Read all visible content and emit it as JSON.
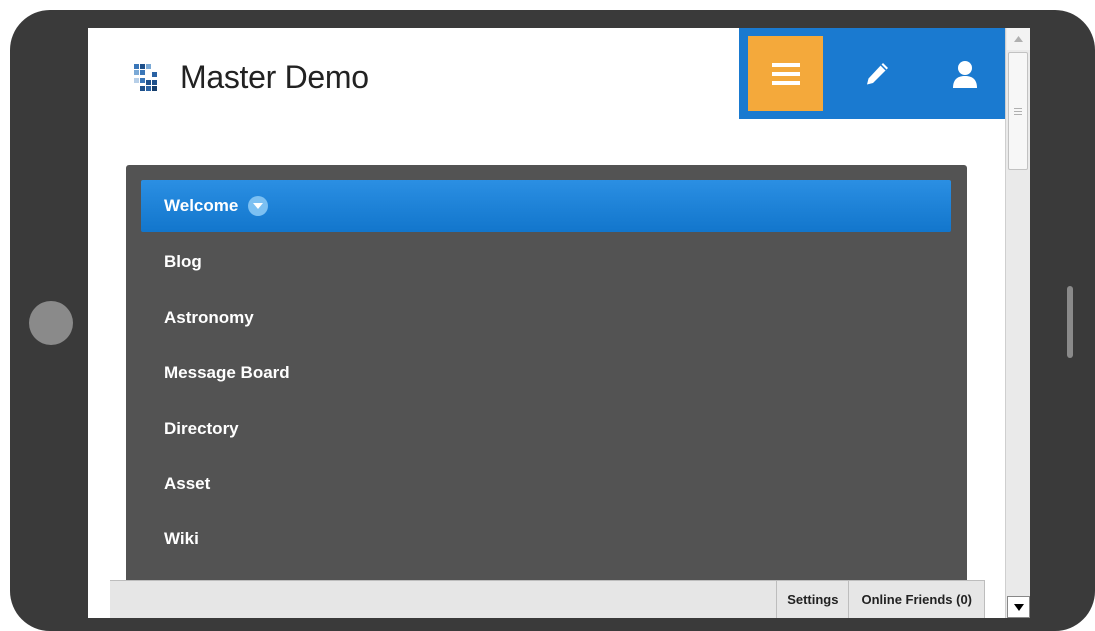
{
  "site": {
    "title": "Master Demo",
    "logo_icon": "grid-logo-icon"
  },
  "header_controls": {
    "menu_icon": "hamburger-icon",
    "edit_icon": "pencil-icon",
    "user_icon": "user-icon",
    "menu_color": "#f4a93b",
    "bar_color": "#1a7ad0"
  },
  "nav": {
    "items": [
      {
        "label": "Welcome",
        "active": true
      },
      {
        "label": "Blog"
      },
      {
        "label": "Astronomy"
      },
      {
        "label": "Message Board"
      },
      {
        "label": "Directory"
      },
      {
        "label": "Asset"
      },
      {
        "label": "Wiki"
      }
    ]
  },
  "dock": {
    "settings_label": "Settings",
    "online_friends_label": "Online Friends (0)"
  }
}
